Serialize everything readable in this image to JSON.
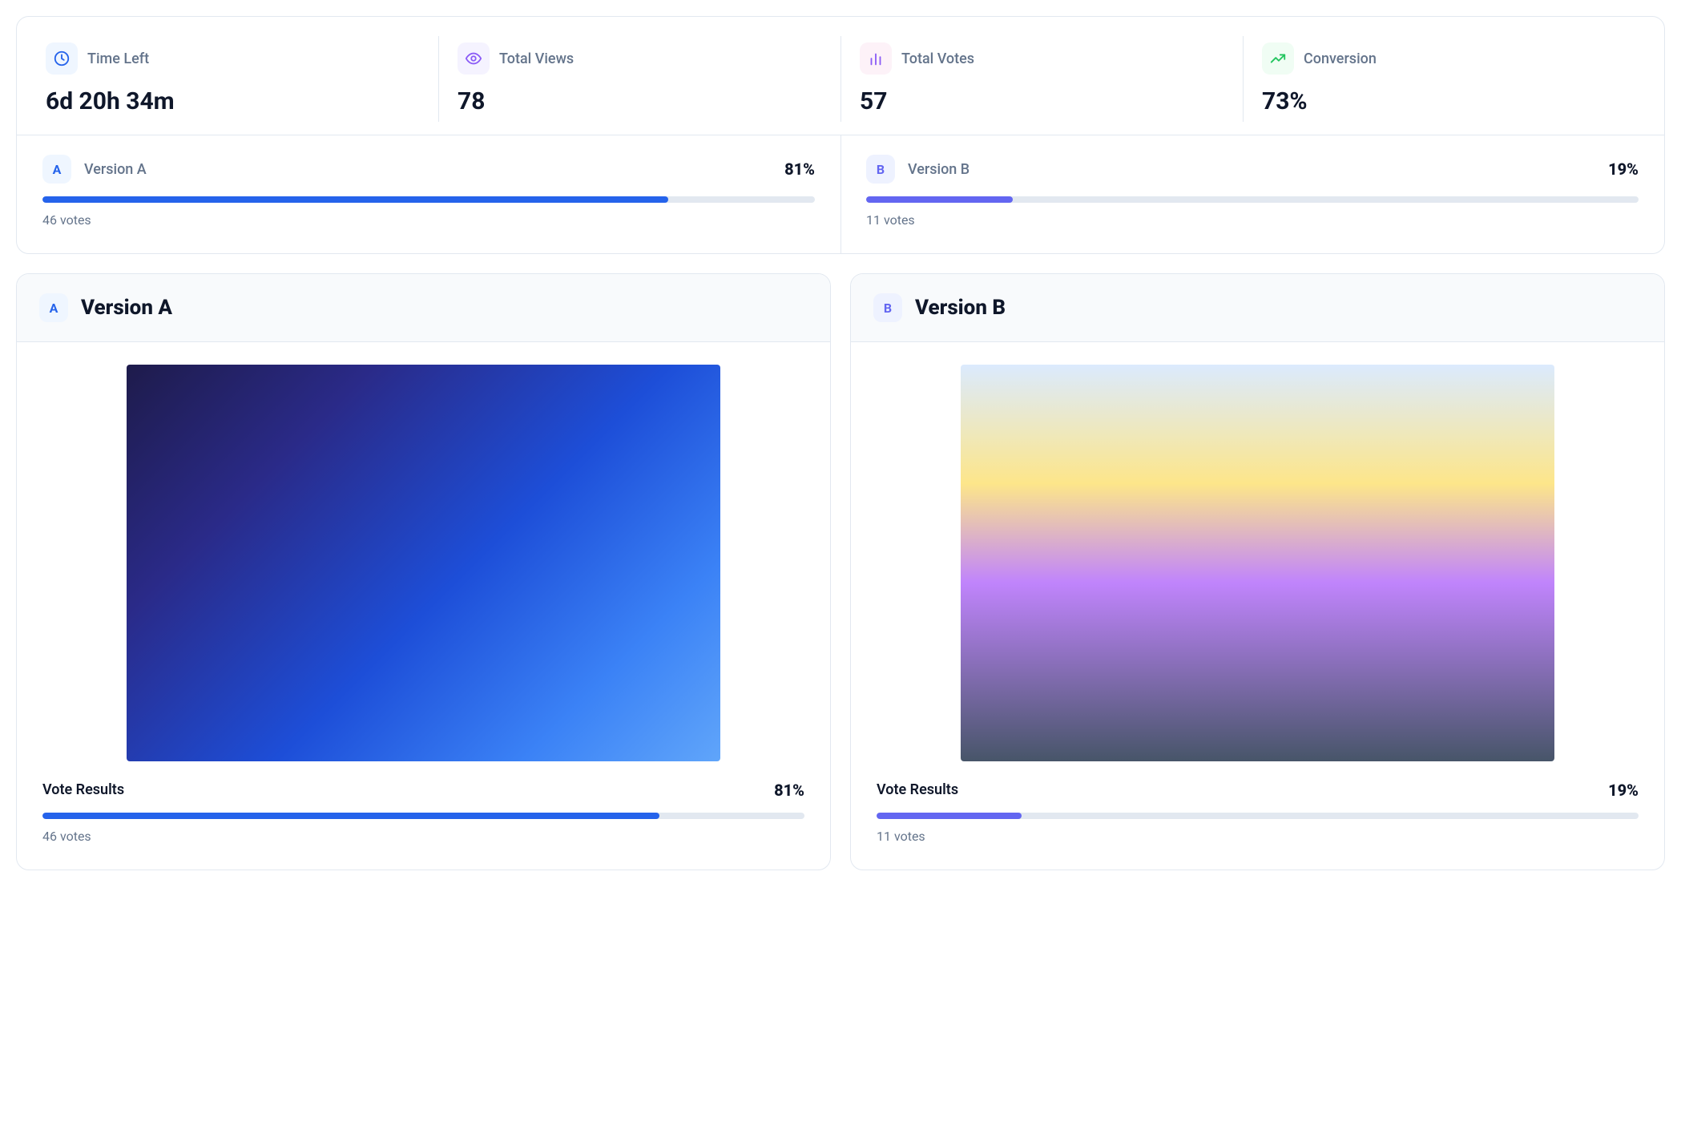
{
  "stats": {
    "time_left": {
      "label": "Time Left",
      "value": "6d 20h 34m"
    },
    "total_views": {
      "label": "Total Views",
      "value": "78"
    },
    "total_votes": {
      "label": "Total Votes",
      "value": "57"
    },
    "conversion": {
      "label": "Conversion",
      "value": "73%"
    }
  },
  "versions": {
    "a": {
      "letter": "A",
      "name": "Version A",
      "percent": "81%",
      "votes": "46 votes",
      "results_label": "Vote Results"
    },
    "b": {
      "letter": "B",
      "name": "Version B",
      "percent": "19%",
      "votes": "11 votes",
      "results_label": "Vote Results"
    }
  }
}
